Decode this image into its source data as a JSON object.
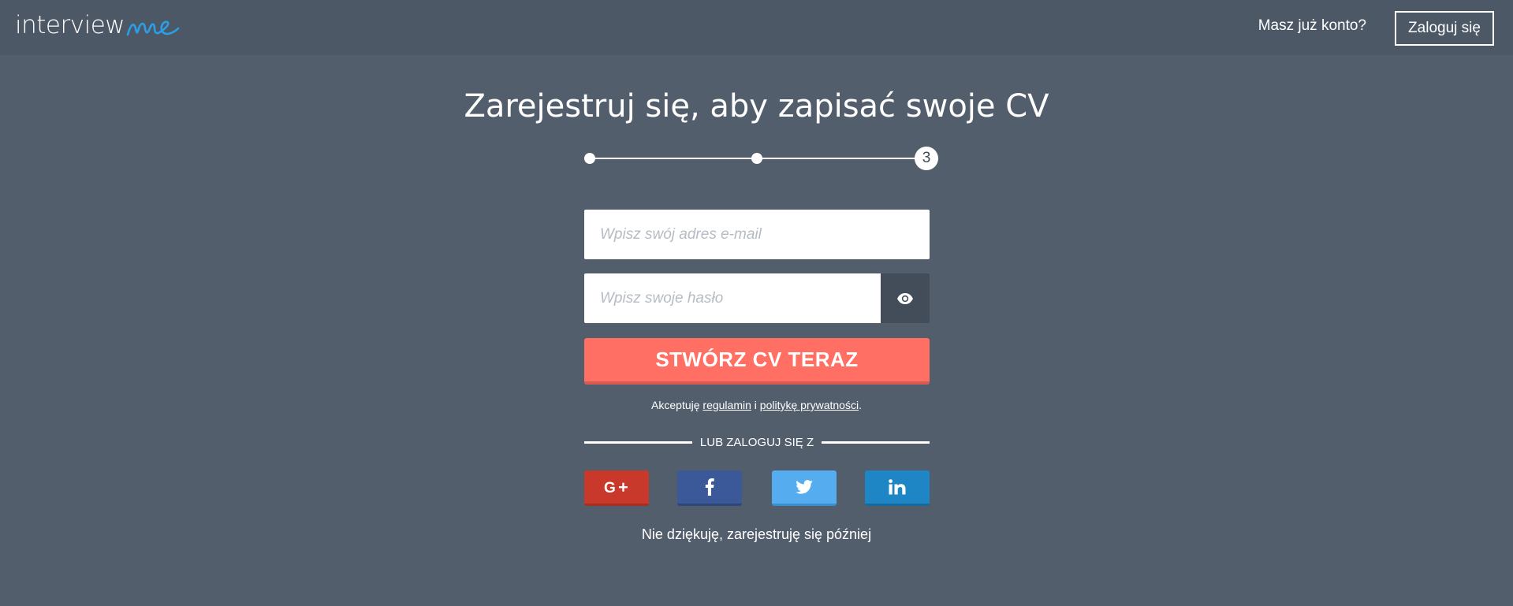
{
  "header": {
    "logo_text": "interview",
    "logo_accent": "me",
    "login_prompt": "Masz już konto?",
    "login_button": "Zaloguj się"
  },
  "main": {
    "title": "Zarejestruj się, aby zapisać swoje CV",
    "stepper": {
      "current_step": "3",
      "total_steps": 3
    },
    "email_placeholder": "Wpisz swój adres e-mail",
    "password_placeholder": "Wpisz swoje hasło",
    "cta_label": "STWÓRZ CV TERAZ",
    "terms": {
      "prefix": "Akceptuję",
      "terms_link": "regulamin",
      "conjunction": "i",
      "privacy_link": "politykę prywatności",
      "suffix": "."
    },
    "divider_text": "LUB ZALOGUJ SIĘ Z",
    "social": [
      {
        "name": "google",
        "icon": "google-plus-icon",
        "color": "#c9392b"
      },
      {
        "name": "facebook",
        "icon": "facebook-icon",
        "color": "#3b5998"
      },
      {
        "name": "twitter",
        "icon": "twitter-icon",
        "color": "#55acee"
      },
      {
        "name": "linkedin",
        "icon": "linkedin-icon",
        "color": "#1e86c4"
      }
    ],
    "skip_link": "Nie dziękuję, zarejestruję się później"
  },
  "colors": {
    "background": "#535e6c",
    "header": "#4d5867",
    "accent": "#ff6f64",
    "logo_accent": "#2b9fe6"
  }
}
